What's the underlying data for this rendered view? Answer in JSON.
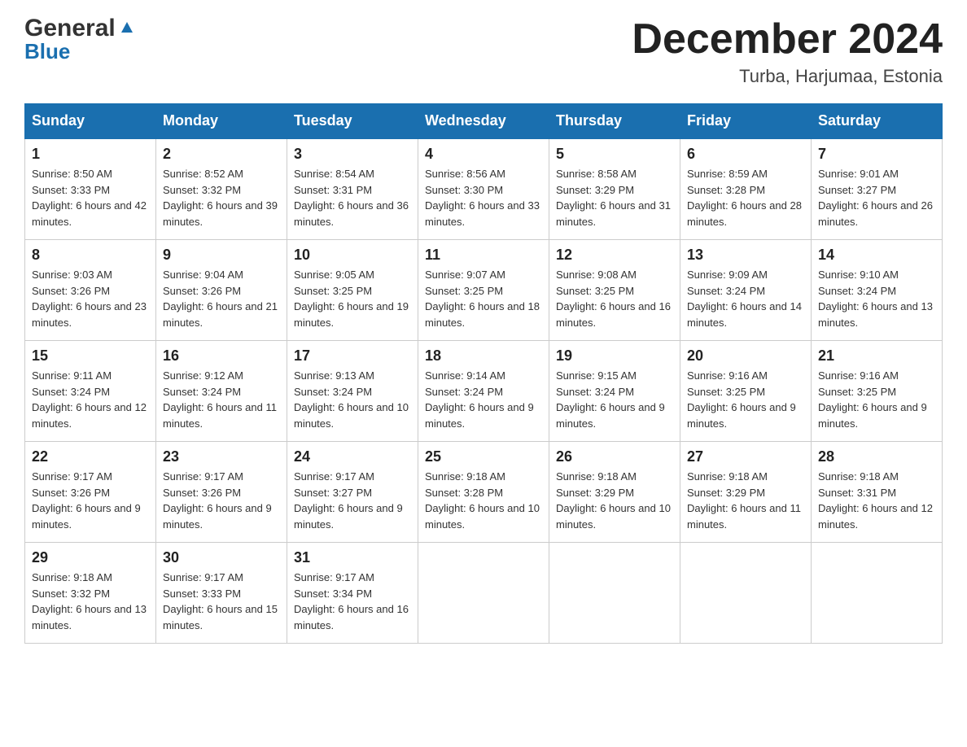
{
  "logo": {
    "general": "General",
    "blue": "Blue"
  },
  "title": {
    "month_year": "December 2024",
    "location": "Turba, Harjumaa, Estonia"
  },
  "days_of_week": [
    "Sunday",
    "Monday",
    "Tuesday",
    "Wednesday",
    "Thursday",
    "Friday",
    "Saturday"
  ],
  "weeks": [
    [
      {
        "day": "1",
        "sunrise": "Sunrise: 8:50 AM",
        "sunset": "Sunset: 3:33 PM",
        "daylight": "Daylight: 6 hours and 42 minutes."
      },
      {
        "day": "2",
        "sunrise": "Sunrise: 8:52 AM",
        "sunset": "Sunset: 3:32 PM",
        "daylight": "Daylight: 6 hours and 39 minutes."
      },
      {
        "day": "3",
        "sunrise": "Sunrise: 8:54 AM",
        "sunset": "Sunset: 3:31 PM",
        "daylight": "Daylight: 6 hours and 36 minutes."
      },
      {
        "day": "4",
        "sunrise": "Sunrise: 8:56 AM",
        "sunset": "Sunset: 3:30 PM",
        "daylight": "Daylight: 6 hours and 33 minutes."
      },
      {
        "day": "5",
        "sunrise": "Sunrise: 8:58 AM",
        "sunset": "Sunset: 3:29 PM",
        "daylight": "Daylight: 6 hours and 31 minutes."
      },
      {
        "day": "6",
        "sunrise": "Sunrise: 8:59 AM",
        "sunset": "Sunset: 3:28 PM",
        "daylight": "Daylight: 6 hours and 28 minutes."
      },
      {
        "day": "7",
        "sunrise": "Sunrise: 9:01 AM",
        "sunset": "Sunset: 3:27 PM",
        "daylight": "Daylight: 6 hours and 26 minutes."
      }
    ],
    [
      {
        "day": "8",
        "sunrise": "Sunrise: 9:03 AM",
        "sunset": "Sunset: 3:26 PM",
        "daylight": "Daylight: 6 hours and 23 minutes."
      },
      {
        "day": "9",
        "sunrise": "Sunrise: 9:04 AM",
        "sunset": "Sunset: 3:26 PM",
        "daylight": "Daylight: 6 hours and 21 minutes."
      },
      {
        "day": "10",
        "sunrise": "Sunrise: 9:05 AM",
        "sunset": "Sunset: 3:25 PM",
        "daylight": "Daylight: 6 hours and 19 minutes."
      },
      {
        "day": "11",
        "sunrise": "Sunrise: 9:07 AM",
        "sunset": "Sunset: 3:25 PM",
        "daylight": "Daylight: 6 hours and 18 minutes."
      },
      {
        "day": "12",
        "sunrise": "Sunrise: 9:08 AM",
        "sunset": "Sunset: 3:25 PM",
        "daylight": "Daylight: 6 hours and 16 minutes."
      },
      {
        "day": "13",
        "sunrise": "Sunrise: 9:09 AM",
        "sunset": "Sunset: 3:24 PM",
        "daylight": "Daylight: 6 hours and 14 minutes."
      },
      {
        "day": "14",
        "sunrise": "Sunrise: 9:10 AM",
        "sunset": "Sunset: 3:24 PM",
        "daylight": "Daylight: 6 hours and 13 minutes."
      }
    ],
    [
      {
        "day": "15",
        "sunrise": "Sunrise: 9:11 AM",
        "sunset": "Sunset: 3:24 PM",
        "daylight": "Daylight: 6 hours and 12 minutes."
      },
      {
        "day": "16",
        "sunrise": "Sunrise: 9:12 AM",
        "sunset": "Sunset: 3:24 PM",
        "daylight": "Daylight: 6 hours and 11 minutes."
      },
      {
        "day": "17",
        "sunrise": "Sunrise: 9:13 AM",
        "sunset": "Sunset: 3:24 PM",
        "daylight": "Daylight: 6 hours and 10 minutes."
      },
      {
        "day": "18",
        "sunrise": "Sunrise: 9:14 AM",
        "sunset": "Sunset: 3:24 PM",
        "daylight": "Daylight: 6 hours and 9 minutes."
      },
      {
        "day": "19",
        "sunrise": "Sunrise: 9:15 AM",
        "sunset": "Sunset: 3:24 PM",
        "daylight": "Daylight: 6 hours and 9 minutes."
      },
      {
        "day": "20",
        "sunrise": "Sunrise: 9:16 AM",
        "sunset": "Sunset: 3:25 PM",
        "daylight": "Daylight: 6 hours and 9 minutes."
      },
      {
        "day": "21",
        "sunrise": "Sunrise: 9:16 AM",
        "sunset": "Sunset: 3:25 PM",
        "daylight": "Daylight: 6 hours and 9 minutes."
      }
    ],
    [
      {
        "day": "22",
        "sunrise": "Sunrise: 9:17 AM",
        "sunset": "Sunset: 3:26 PM",
        "daylight": "Daylight: 6 hours and 9 minutes."
      },
      {
        "day": "23",
        "sunrise": "Sunrise: 9:17 AM",
        "sunset": "Sunset: 3:26 PM",
        "daylight": "Daylight: 6 hours and 9 minutes."
      },
      {
        "day": "24",
        "sunrise": "Sunrise: 9:17 AM",
        "sunset": "Sunset: 3:27 PM",
        "daylight": "Daylight: 6 hours and 9 minutes."
      },
      {
        "day": "25",
        "sunrise": "Sunrise: 9:18 AM",
        "sunset": "Sunset: 3:28 PM",
        "daylight": "Daylight: 6 hours and 10 minutes."
      },
      {
        "day": "26",
        "sunrise": "Sunrise: 9:18 AM",
        "sunset": "Sunset: 3:29 PM",
        "daylight": "Daylight: 6 hours and 10 minutes."
      },
      {
        "day": "27",
        "sunrise": "Sunrise: 9:18 AM",
        "sunset": "Sunset: 3:29 PM",
        "daylight": "Daylight: 6 hours and 11 minutes."
      },
      {
        "day": "28",
        "sunrise": "Sunrise: 9:18 AM",
        "sunset": "Sunset: 3:31 PM",
        "daylight": "Daylight: 6 hours and 12 minutes."
      }
    ],
    [
      {
        "day": "29",
        "sunrise": "Sunrise: 9:18 AM",
        "sunset": "Sunset: 3:32 PM",
        "daylight": "Daylight: 6 hours and 13 minutes."
      },
      {
        "day": "30",
        "sunrise": "Sunrise: 9:17 AM",
        "sunset": "Sunset: 3:33 PM",
        "daylight": "Daylight: 6 hours and 15 minutes."
      },
      {
        "day": "31",
        "sunrise": "Sunrise: 9:17 AM",
        "sunset": "Sunset: 3:34 PM",
        "daylight": "Daylight: 6 hours and 16 minutes."
      },
      null,
      null,
      null,
      null
    ]
  ]
}
